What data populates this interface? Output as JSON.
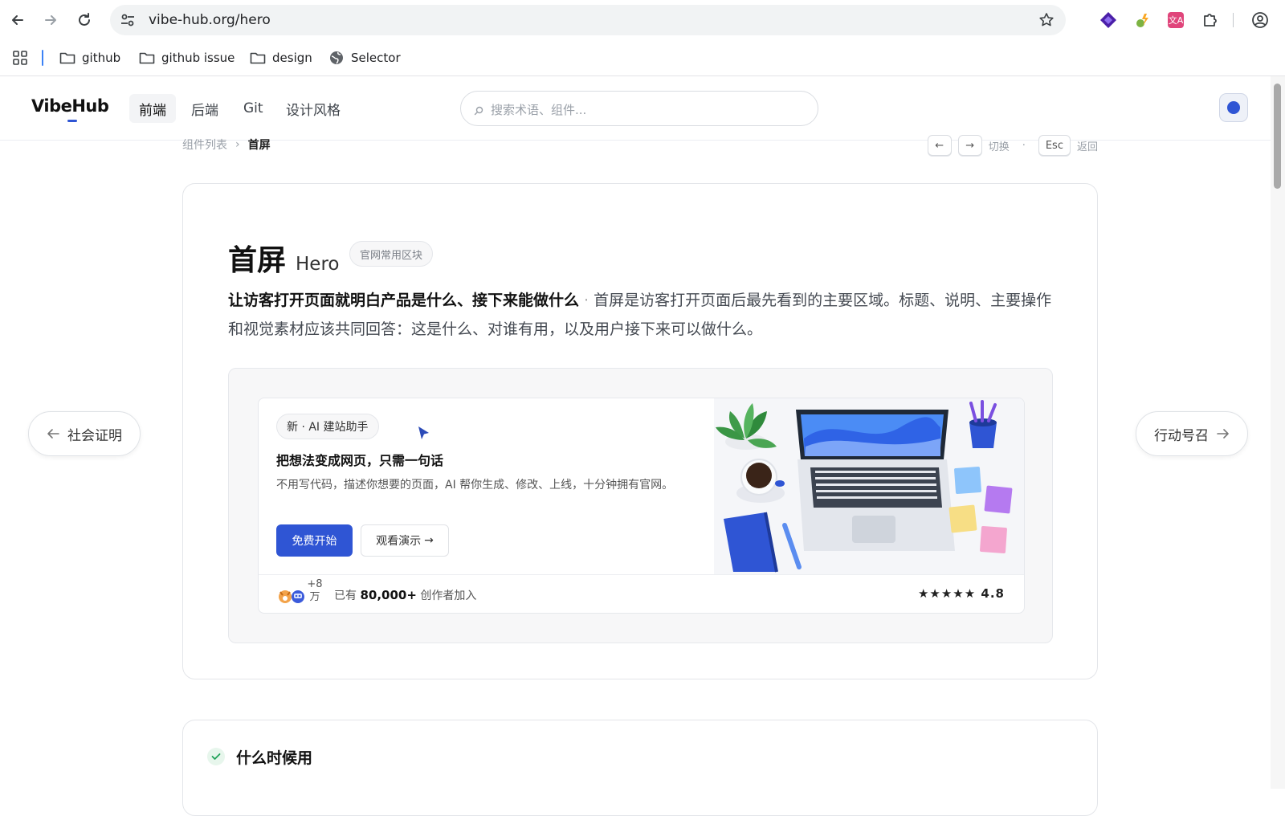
{
  "browser": {
    "url": "vibe-hub.org/hero",
    "bookmarks": [
      {
        "label": "github",
        "icon": "folder-icon"
      },
      {
        "label": "github issue",
        "icon": "folder-icon"
      },
      {
        "label": "design",
        "icon": "folder-icon"
      },
      {
        "label": "Selector",
        "icon": "globe-icon"
      }
    ]
  },
  "site": {
    "logo": "VibeHub",
    "nav": [
      "前端",
      "后端",
      "Git",
      "设计风格"
    ],
    "search_placeholder": "搜索术语、组件...",
    "accent": "#2f55d4"
  },
  "breadcrumb": {
    "parent": "组件列表",
    "current": "首屏"
  },
  "shortcuts": {
    "prev_key": "←",
    "next_key": "→",
    "switch_label": "切换",
    "sep": "·",
    "esc_key": "Esc",
    "back_label": "返回"
  },
  "page": {
    "title_zh": "首屏",
    "title_en": "Hero",
    "tag": "官网常用区块",
    "lead_bold": "让访客打开页面就明白产品是什么、接下来能做什么",
    "lead_sep": "·",
    "lead_text": "首屏是访客打开页面后最先看到的主要区域。标题、说明、主要操作和视觉素材应该共同回答：这是什么、对谁有用，以及用户接下来可以做什么。"
  },
  "preview": {
    "pill": "新 · AI 建站助手",
    "title": "把想法变成网页，只需一句话",
    "desc": "不用写代码，描述你想要的页面，AI 帮你生成、修改、上线，十分钟拥有官网。",
    "primary_btn": "免费开始",
    "ghost_btn": "观看演示",
    "ghost_arrow": "→",
    "avatar_count": "+8万",
    "join_prefix": "已有",
    "join_count": "80,000+",
    "join_suffix": "创作者加入",
    "stars": "★★★★★",
    "rating": "4.8"
  },
  "side_nav": {
    "prev": "社会证明",
    "next": "行动号召"
  },
  "section2": {
    "title": "什么时候用"
  }
}
